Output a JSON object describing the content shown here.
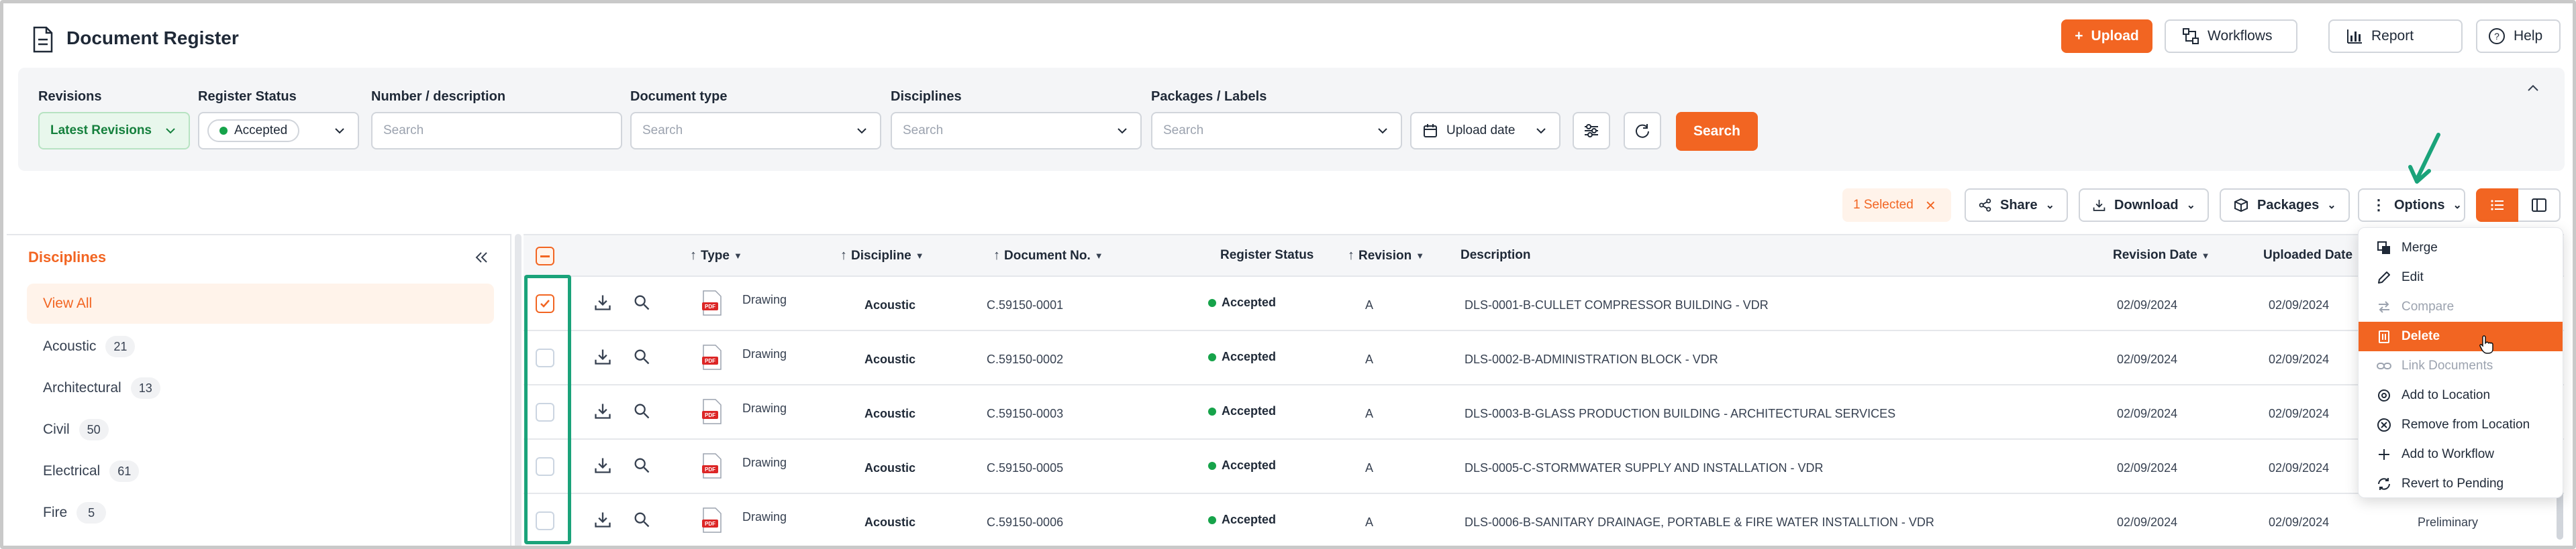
{
  "header": {
    "title": "Document Register",
    "upload_label": "Upload",
    "workflows_label": "Workflows",
    "report_label": "Report",
    "help_label": "Help"
  },
  "filters": {
    "revisions": {
      "label": "Revisions",
      "value": "Latest Revisions"
    },
    "register_status": {
      "label": "Register Status",
      "value": "Accepted"
    },
    "number_description": {
      "label": "Number / description",
      "placeholder": "Search"
    },
    "document_type": {
      "label": "Document type",
      "placeholder": "Search"
    },
    "disciplines": {
      "label": "Disciplines",
      "placeholder": "Search"
    },
    "packages_labels": {
      "label": "Packages / Labels",
      "placeholder": "Search"
    },
    "upload_date_label": "Upload date",
    "search_label": "Search"
  },
  "actions": {
    "selected_label": "1 Selected",
    "share_label": "Share",
    "download_label": "Download",
    "packages_label": "Packages",
    "options_label": "Options"
  },
  "sidebar": {
    "title": "Disciplines",
    "items": [
      {
        "label": "View All",
        "count": ""
      },
      {
        "label": "Acoustic",
        "count": "21"
      },
      {
        "label": "Architectural",
        "count": "13"
      },
      {
        "label": "Civil",
        "count": "50"
      },
      {
        "label": "Electrical",
        "count": "61"
      },
      {
        "label": "Fire",
        "count": "5"
      }
    ]
  },
  "table": {
    "columns": {
      "type": "Type",
      "discipline": "Discipline",
      "document_no": "Document No.",
      "register_status": "Register Status",
      "revision": "Revision",
      "description": "Description",
      "revision_date": "Revision Date",
      "uploaded_date": "Uploaded Date"
    },
    "rows": [
      {
        "type": "Drawing",
        "discipline": "Acoustic",
        "document_no": "C.59150-0001",
        "status": "Accepted",
        "revision": "A",
        "description": "DLS-0001-B-CULLET COMPRESSOR BUILDING - VDR",
        "revision_date": "02/09/2024",
        "uploaded_date": "02/09/2024",
        "extra": ""
      },
      {
        "type": "Drawing",
        "discipline": "Acoustic",
        "document_no": "C.59150-0002",
        "status": "Accepted",
        "revision": "A",
        "description": "DLS-0002-B-ADMINISTRATION BLOCK - VDR",
        "revision_date": "02/09/2024",
        "uploaded_date": "02/09/2024",
        "extra": ""
      },
      {
        "type": "Drawing",
        "discipline": "Acoustic",
        "document_no": "C.59150-0003",
        "status": "Accepted",
        "revision": "A",
        "description": "DLS-0003-B-GLASS PRODUCTION BUILDING - ARCHITECTURAL SERVICES",
        "revision_date": "02/09/2024",
        "uploaded_date": "02/09/2024",
        "extra": ""
      },
      {
        "type": "Drawing",
        "discipline": "Acoustic",
        "document_no": "C.59150-0005",
        "status": "Accepted",
        "revision": "A",
        "description": "DLS-0005-C-STORMWATER SUPPLY AND INSTALLATION - VDR",
        "revision_date": "02/09/2024",
        "uploaded_date": "02/09/2024",
        "extra": ""
      },
      {
        "type": "Drawing",
        "discipline": "Acoustic",
        "document_no": "C.59150-0006",
        "status": "Accepted",
        "revision": "A",
        "description": "DLS-0006-B-SANITARY DRAINAGE, PORTABLE & FIRE WATER INSTALLTION - VDR",
        "revision_date": "02/09/2024",
        "uploaded_date": "02/09/2024",
        "extra": "Preliminary"
      }
    ]
  },
  "options_menu": {
    "items": [
      {
        "label": "Merge"
      },
      {
        "label": "Edit"
      },
      {
        "label": "Compare"
      },
      {
        "label": "Delete"
      },
      {
        "label": "Link Documents"
      },
      {
        "label": "Add to Location"
      },
      {
        "label": "Remove from Location"
      },
      {
        "label": "Add to Workflow"
      },
      {
        "label": "Revert to Pending"
      }
    ]
  },
  "colors": {
    "accent": "#f26522",
    "success": "#16a34a",
    "annotation": "#1aa37a"
  }
}
